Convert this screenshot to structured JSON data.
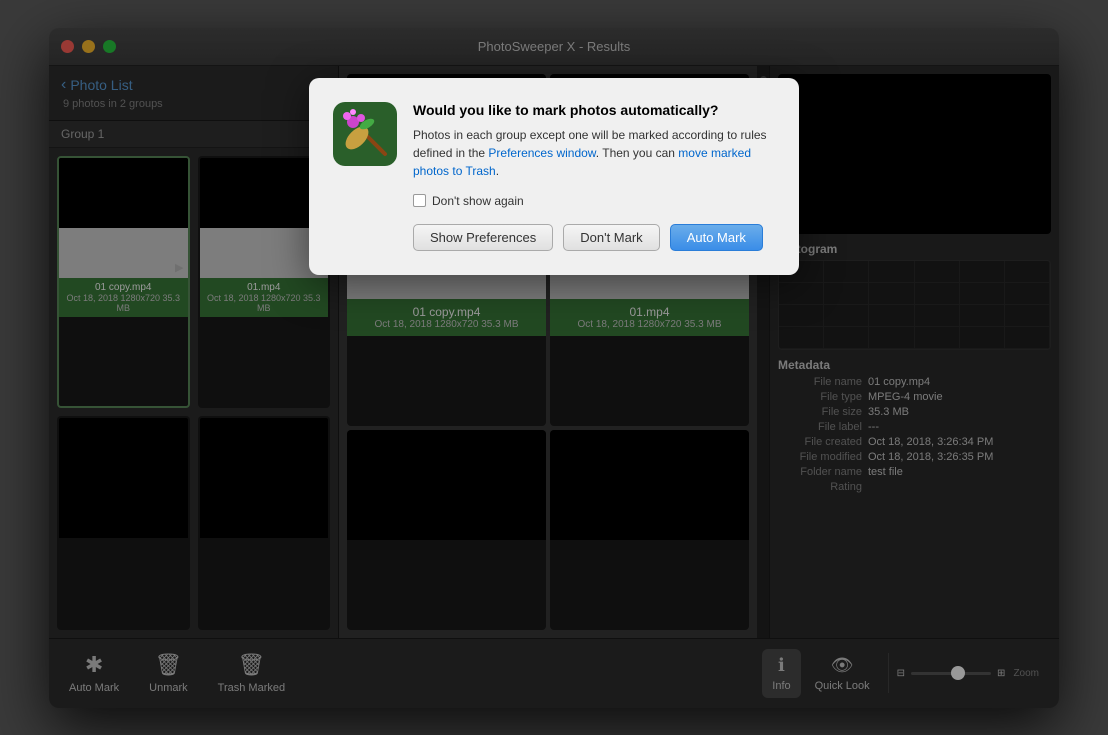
{
  "window": {
    "title": "PhotoSweeper X - Results"
  },
  "sidebar": {
    "back_label": "Photo List",
    "count_label": "9 photos in 2 groups",
    "group_label": "Group 1"
  },
  "photos": [
    {
      "name": "01 copy.mp4",
      "meta": "Oct 18, 2018  1280x720  35.3 MB",
      "selected": true
    },
    {
      "name": "01.mp4",
      "meta": "Oct 18, 2018  1280x720  35.3 MB",
      "selected": false
    }
  ],
  "right_panel": {
    "histogram_title": "Histogram",
    "metadata_title": "Metadata",
    "metadata": {
      "file_name_label": "File name",
      "file_name_value": "01 copy.mp4",
      "file_type_label": "File type",
      "file_type_value": "MPEG-4 movie",
      "file_size_label": "File size",
      "file_size_value": "35.3 MB",
      "file_label_label": "File label",
      "file_label_value": "---",
      "file_created_label": "File created",
      "file_created_value": "Oct 18, 2018, 3:26:34 PM",
      "file_modified_label": "File modified",
      "file_modified_value": "Oct 18, 2018, 3:26:35 PM",
      "folder_name_label": "Folder name",
      "folder_name_value": "test file",
      "rating_label": "Rating"
    }
  },
  "toolbar": {
    "auto_mark_label": "Auto Mark",
    "unmark_label": "Unmark",
    "trash_marked_label": "Trash Marked",
    "info_label": "Info",
    "quick_look_label": "Quick Look",
    "zoom_label": "Zoom"
  },
  "modal": {
    "title": "Would you like to mark photos automatically?",
    "body_text": "Photos in each group except one will be marked according to rules defined in the Preferences window. Then you can move marked photos to Trash.",
    "checkbox_label": "Don't show again",
    "btn_show_prefs": "Show Preferences",
    "btn_dont_mark": "Don't Mark",
    "btn_auto_mark": "Auto Mark"
  }
}
